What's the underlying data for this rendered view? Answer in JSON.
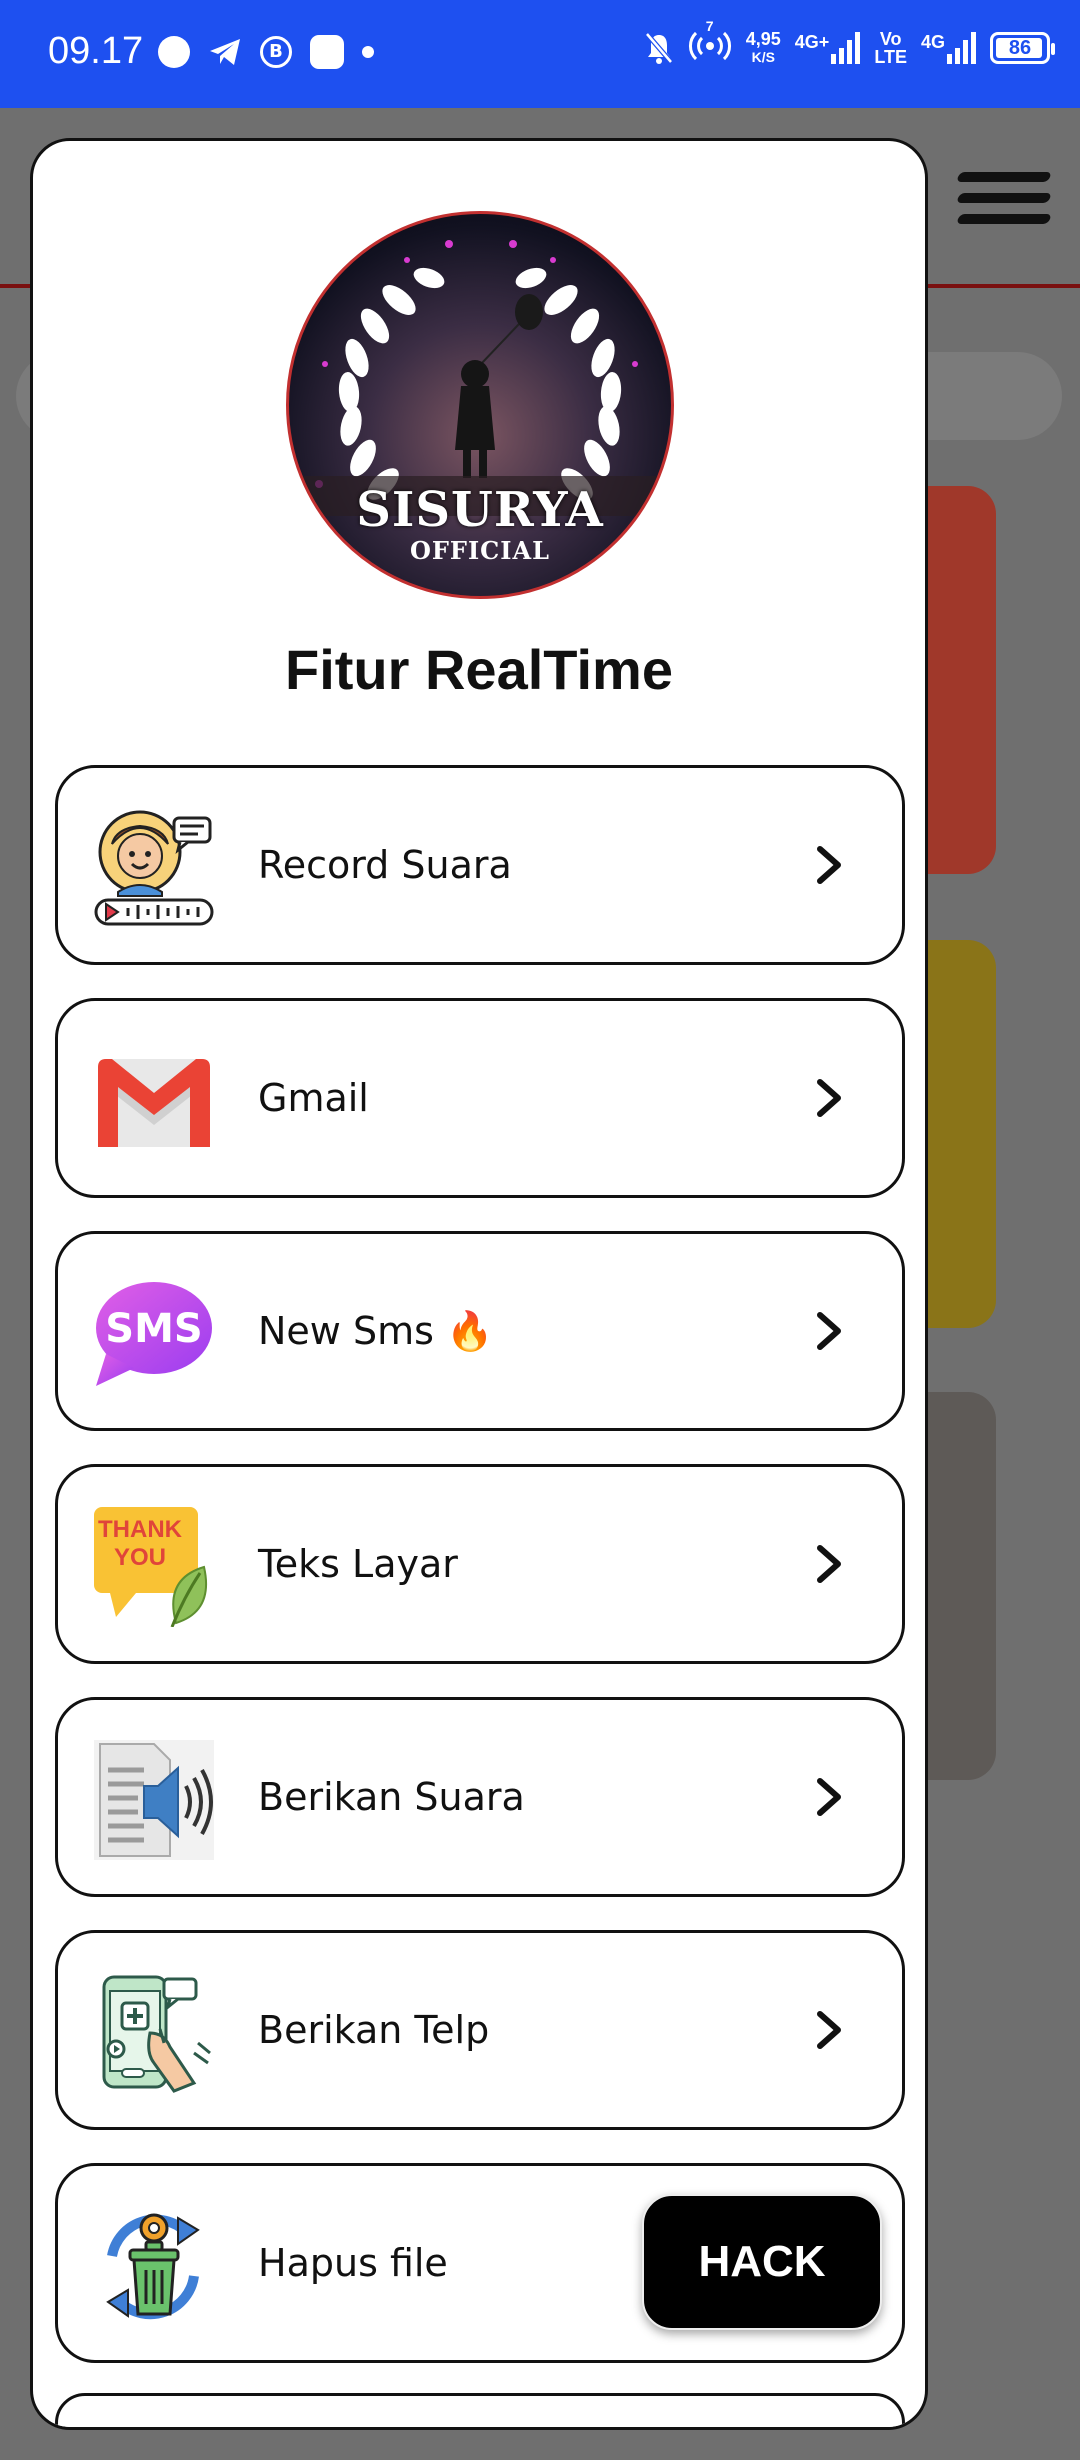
{
  "status_bar": {
    "time": "09.17",
    "speed_value": "4,95",
    "speed_unit": "K/S",
    "network_1": "4G+",
    "volte_top": "Vo",
    "volte_bottom": "LTE",
    "network_2": "4G",
    "hotspot_badge": "7",
    "battery_level": "86",
    "colors": {
      "background": "#1e50f0"
    }
  },
  "modal": {
    "avatar": {
      "brand": "SISURYA",
      "sub": "OFFICIAL"
    },
    "title": "Fitur RealTime",
    "items": [
      {
        "label": "Record Suara",
        "icon": "voice-record-icon"
      },
      {
        "label": "Gmail",
        "icon": "gmail-icon"
      },
      {
        "label": "New Sms 🔥",
        "icon": "sms-icon"
      },
      {
        "label": "Teks Layar",
        "icon": "thank-you-note-icon",
        "icon_text_1": "THANK",
        "icon_text_2": "YOU"
      },
      {
        "label": "Berikan Suara",
        "icon": "speaker-document-icon"
      },
      {
        "label": "Berikan Telp",
        "icon": "phone-touch-icon"
      },
      {
        "label": "Hapus file",
        "icon": "delete-file-icon"
      }
    ],
    "sms_icon_text": "SMS"
  },
  "hack_button": {
    "label": "HACK"
  },
  "background": {
    "colors": {
      "overlay": "#6f6f6f",
      "card_red": "#a0382a",
      "card_yellow": "#8a7418",
      "card_gray": "#5e5a57"
    }
  }
}
